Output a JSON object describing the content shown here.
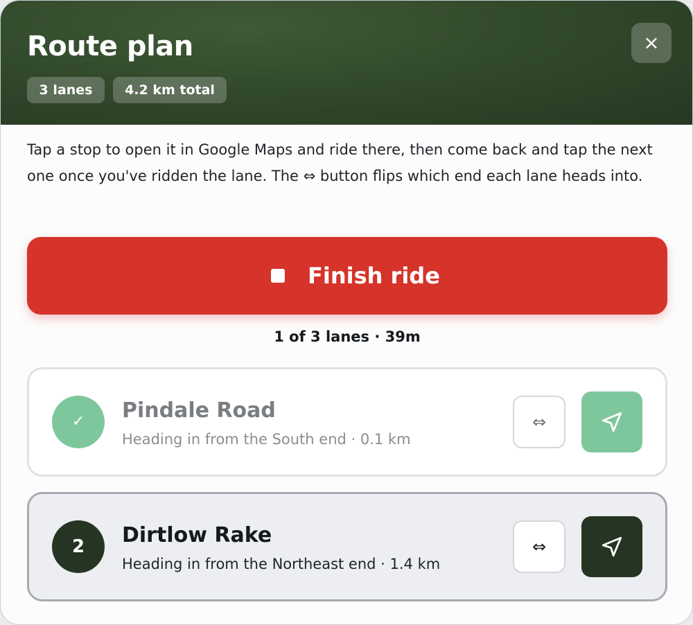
{
  "header": {
    "title": "Route plan",
    "chips": [
      "3 lanes",
      "4.2 km total"
    ],
    "close_icon": "×"
  },
  "intro": "Tap a stop to open it in Google Maps and ride there, then come back and tap the next one once you've ridden the lane. The ⇔ button flips which end each lane heads into.",
  "finish_button": {
    "label": "Finish ride",
    "icon": "stop-icon"
  },
  "progress": "1 of 3 lanes · 39m",
  "lanes": [
    {
      "badge": "✓",
      "name": "Pindale Road",
      "detail": "Heading in from the South end · 0.1 km",
      "flip_icon": "⇔",
      "state": "done"
    },
    {
      "badge": "2",
      "name": "Dirtlow Rake",
      "detail": "Heading in from the Northeast end · 1.4 km",
      "flip_icon": "⇔",
      "state": "current"
    }
  ],
  "colors": {
    "header_bg": "#2f4529",
    "finish_red": "#d6332a",
    "done_green": "#7ec79c",
    "current_dark": "#263523"
  }
}
